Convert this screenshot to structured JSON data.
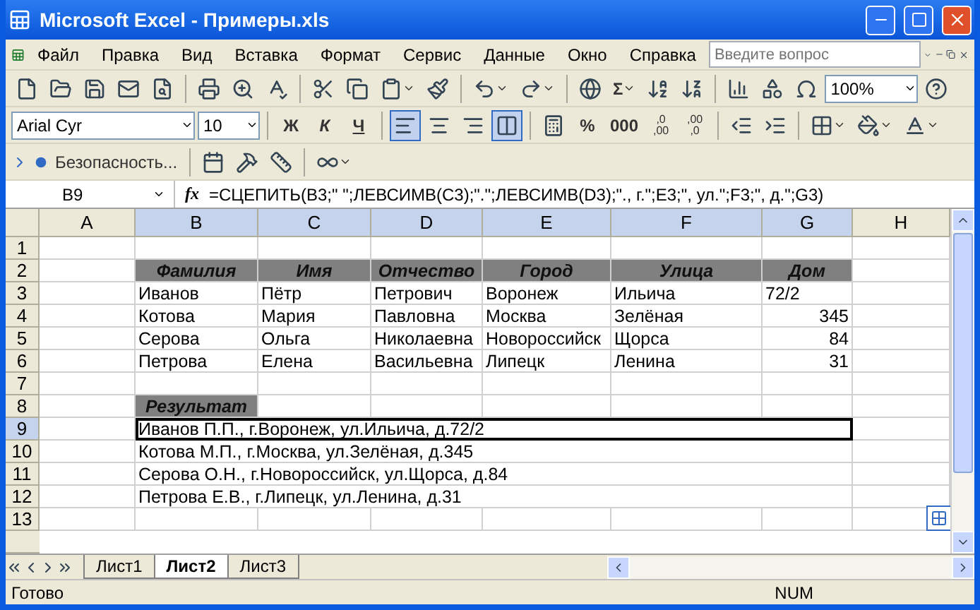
{
  "window": {
    "title": "Microsoft Excel - Примеры.xls"
  },
  "menu": {
    "items": [
      "Файл",
      "Правка",
      "Вид",
      "Вставка",
      "Формат",
      "Сервис",
      "Данные",
      "Окно",
      "Справка"
    ],
    "help_placeholder": "Введите вопрос"
  },
  "standard_toolbar": {
    "sum_label": "Σ",
    "zoom": "100%"
  },
  "format_toolbar": {
    "font": "Arial Cyr",
    "size": "10",
    "style_buttons": [
      {
        "kind": "bold",
        "label": "Ж",
        "pressed": false
      },
      {
        "kind": "italic",
        "label": "К",
        "pressed": false
      },
      {
        "kind": "underline",
        "label": "Ч",
        "pressed": false
      }
    ],
    "align_buttons": [
      {
        "kind": "left",
        "pressed": true
      },
      {
        "kind": "center",
        "pressed": false
      },
      {
        "kind": "right",
        "pressed": false
      },
      {
        "kind": "merge",
        "pressed": true
      }
    ],
    "percent": "%",
    "thousands": "000",
    "decimal_more": [
      ",0",
      ",00"
    ],
    "decimal_less": [
      ",00",
      ",0"
    ]
  },
  "security_toolbar": {
    "label": "Безопасность..."
  },
  "formula_bar": {
    "name_box": "B9",
    "fx": "fx",
    "formula": "=СЦЕПИТЬ(B3;\"   \";ЛЕВСИМВ(C3);\".\";ЛЕВСИМВ(D3);\"., г.\";E3;\", ул.\";F3;\", д.\";G3)"
  },
  "sheet": {
    "columns": [
      {
        "label": "A",
        "selected": false
      },
      {
        "label": "B",
        "selected": true
      },
      {
        "label": "C",
        "selected": true
      },
      {
        "label": "D",
        "selected": true
      },
      {
        "label": "E",
        "selected": true
      },
      {
        "label": "F",
        "selected": true
      },
      {
        "label": "G",
        "selected": true
      },
      {
        "label": "H",
        "selected": false
      }
    ],
    "rows": [
      {
        "number": "1",
        "selected": false,
        "cells": []
      },
      {
        "number": "2",
        "selected": false,
        "cells": [
          "",
          {
            "kind": "header",
            "text": "Фамилия"
          },
          {
            "kind": "header",
            "text": "Имя"
          },
          {
            "kind": "header",
            "text": "Отчество"
          },
          {
            "kind": "header",
            "text": "Город"
          },
          {
            "kind": "header",
            "text": "Улица"
          },
          {
            "kind": "header",
            "text": "Дом"
          }
        ]
      },
      {
        "number": "3",
        "selected": false,
        "cells": [
          "",
          {
            "kind": "text",
            "text": "Иванов"
          },
          {
            "kind": "text",
            "text": "Пётр"
          },
          {
            "kind": "text",
            "text": "Петрович"
          },
          {
            "kind": "text",
            "text": "Воронеж"
          },
          {
            "kind": "text",
            "text": "Ильича"
          },
          {
            "kind": "text",
            "text": "72/2"
          }
        ]
      },
      {
        "number": "4",
        "selected": false,
        "cells": [
          "",
          {
            "kind": "text",
            "text": "Котова"
          },
          {
            "kind": "text",
            "text": "Мария"
          },
          {
            "kind": "text",
            "text": "Павловна"
          },
          {
            "kind": "text",
            "text": "Москва"
          },
          {
            "kind": "text",
            "text": "Зелёная"
          },
          {
            "kind": "number",
            "text": "345"
          }
        ]
      },
      {
        "number": "5",
        "selected": false,
        "cells": [
          "",
          {
            "kind": "text",
            "text": "Серова"
          },
          {
            "kind": "text",
            "text": "Ольга"
          },
          {
            "kind": "text",
            "text": "Николаевна"
          },
          {
            "kind": "text",
            "text": "Новороссийск"
          },
          {
            "kind": "text",
            "text": "Щорса"
          },
          {
            "kind": "number",
            "text": "84"
          }
        ]
      },
      {
        "number": "6",
        "selected": false,
        "cells": [
          "",
          {
            "kind": "text",
            "text": "Петрова"
          },
          {
            "kind": "text",
            "text": "Елена"
          },
          {
            "kind": "text",
            "text": "Васильевна"
          },
          {
            "kind": "text",
            "text": "Липецк"
          },
          {
            "kind": "text",
            "text": "Ленина"
          },
          {
            "kind": "number",
            "text": "31"
          }
        ]
      },
      {
        "number": "7",
        "selected": false,
        "cells": []
      },
      {
        "number": "8",
        "selected": false,
        "cells": [
          "",
          {
            "kind": "header",
            "text": "Результат"
          }
        ]
      },
      {
        "number": "9",
        "selected": true,
        "cells": [
          "",
          {
            "kind": "spill",
            "text": "Иванов   П.П., г.Воронеж, ул.Ильича, д.72/2"
          }
        ]
      },
      {
        "number": "10",
        "selected": false,
        "cells": [
          "",
          {
            "kind": "spill",
            "text": "Котова   М.П., г.Москва, ул.Зелёная, д.345"
          }
        ]
      },
      {
        "number": "11",
        "selected": false,
        "cells": [
          "",
          {
            "kind": "spill",
            "text": "Серова   О.Н., г.Новороссийск, ул.Щорса, д.84"
          }
        ]
      },
      {
        "number": "12",
        "selected": false,
        "cells": [
          "",
          {
            "kind": "spill",
            "text": "Петрова   Е.В., г.Липецк, ул.Ленина, д.31"
          }
        ]
      },
      {
        "number": "13",
        "selected": false,
        "cells": []
      }
    ]
  },
  "sheet_tabs": [
    {
      "label": "Лист1",
      "selected": false
    },
    {
      "label": "Лист2",
      "selected": true
    },
    {
      "label": "Лист3",
      "selected": false
    }
  ],
  "status_bar": {
    "status": "Готово",
    "num": "NUM"
  }
}
